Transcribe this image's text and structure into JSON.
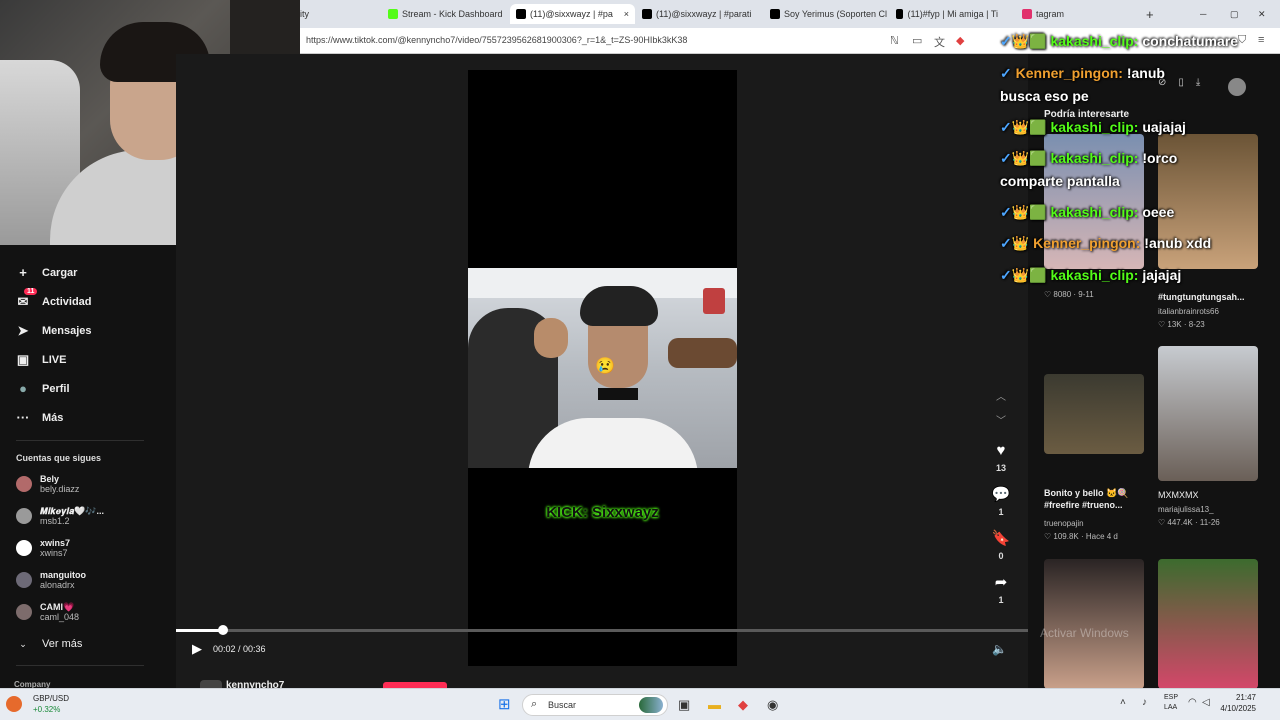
{
  "browser": {
    "tabs": [
      {
        "label": "ity",
        "color": "#dfe3ea"
      },
      {
        "label": "Stream - Kick Dashboard",
        "color": "#53fc18"
      },
      {
        "label": "(11)@sixxwayz | #pa",
        "color": "#000000",
        "active": true
      },
      {
        "label": "(11)@sixxwayz | #parati",
        "color": "#000000"
      },
      {
        "label": "Soy Yerimus (Soporten Cl",
        "color": "#000000"
      },
      {
        "label": "(11)#fyp | Mi amiga | Ti",
        "color": "#000000"
      },
      {
        "label": "tagram",
        "color": "#e1306c"
      }
    ],
    "url": "https://www.tiktok.com/@kennyncho7/video/7557239562681900306?_r=1&_t=ZS-90HIbk3kK38",
    "close_tab_glyph": "×",
    "new_tab_glyph": "+"
  },
  "nav": {
    "items": [
      {
        "label": "Cargar",
        "icon": "+"
      },
      {
        "label": "Actividad",
        "icon": "✉",
        "badge": "11"
      },
      {
        "label": "Mensajes",
        "icon": "➤"
      },
      {
        "label": "LIVE",
        "icon": "▣"
      },
      {
        "label": "Perfil",
        "icon": "●"
      },
      {
        "label": "Más",
        "icon": "···"
      }
    ],
    "following_title": "Cuentas que sigues",
    "following": [
      {
        "name": "Bely",
        "handle": "bely.diazz"
      },
      {
        "name": "𝑴𝒊𝒌𝒆𝒚𝒍𝒂🤍🎶...",
        "handle": "msb1.2"
      },
      {
        "name": "xwins7",
        "handle": "xwins7"
      },
      {
        "name": "manguitoo",
        "handle": "alonadrx"
      },
      {
        "name": "CAMI💗",
        "handle": "caml_048"
      }
    ],
    "see_more": "Ver más",
    "company": "Company"
  },
  "player": {
    "overlay_text": "KICK: Sixxwayz",
    "current_time": "00:02",
    "duration": "00:36",
    "time_display": "00:02 / 00:36",
    "progress": 0.0556,
    "emoji": "😢",
    "author": "kennyncho7",
    "actions": [
      {
        "name": "like",
        "icon": "♥",
        "count": "13"
      },
      {
        "name": "comment",
        "icon": "💬",
        "count": "1"
      },
      {
        "name": "save",
        "icon": "🔖",
        "count": "0"
      },
      {
        "name": "share",
        "icon": "➦",
        "count": "1"
      }
    ]
  },
  "recommendations": {
    "title": "Podría interesarte",
    "items": [
      {
        "caption": "",
        "user": "",
        "meta": "♡ 8080 · 9-11",
        "colors": [
          "#7a8fb0",
          "#d6b6b6"
        ]
      },
      {
        "caption": "#tungtungtungsah...",
        "user": "italianbrainrots66",
        "meta": "♡ 13K · 8-23",
        "colors": [
          "#6b5436",
          "#c9a27a"
        ]
      },
      {
        "caption": "Bonito y bello 🐱🍭 #freefire #trueno...",
        "user": "truenopajin",
        "meta": "♡ 109.8K · Hace 4 d",
        "colors": [
          "#3b3a30",
          "#6b5c42"
        ]
      },
      {
        "caption": "MXMXMX",
        "user": "mariajulissa13_",
        "meta": "♡ 447.4K · 11-26",
        "colors": [
          "#c7cbd0",
          "#6a5f57"
        ]
      },
      {
        "caption": "",
        "user": "",
        "meta": "",
        "colors": [
          "#2a2424",
          "#c9a08a"
        ]
      },
      {
        "caption": "",
        "user": "",
        "meta": "",
        "colors": [
          "#3c6b2e",
          "#d4476a"
        ]
      }
    ]
  },
  "chat": [
    {
      "user": "kakashi_clip",
      "msg": "conchatumare",
      "color": "green",
      "badges": "✓👑🟩"
    },
    {
      "user": "Kenner_pingon",
      "msg": "!anub",
      "color": "orange",
      "badges": "✓"
    },
    {
      "user": "",
      "msg": "busca eso pe",
      "color": "white",
      "badges": ""
    },
    {
      "user": "kakashi_clip",
      "msg": "uajajaj",
      "color": "green",
      "badges": "✓👑🟩"
    },
    {
      "user": "kakashi_clip",
      "msg": "!orco",
      "color": "green",
      "badges": "✓👑🟩"
    },
    {
      "user": "",
      "msg": "comparte pantalla",
      "color": "white",
      "badges": ""
    },
    {
      "user": "kakashi_clip",
      "msg": "oeee",
      "color": "green",
      "badges": "✓👑🟩"
    },
    {
      "user": "Kenner_pingon",
      "msg": "!anub xdd",
      "color": "orange",
      "badges": "✓👑"
    },
    {
      "user": "kakashi_clip",
      "msg": "jajajaj",
      "color": "green",
      "badges": "✓👑🟩"
    }
  ],
  "watermark": "Activar Windows",
  "taskbar": {
    "ticker_symbol": "GBP/USD",
    "ticker_change": "+0.32%",
    "search_label": "Buscar",
    "lang_top": "ESP",
    "lang_bottom": "LAA",
    "time": "21:47",
    "date": "4/10/2025"
  }
}
